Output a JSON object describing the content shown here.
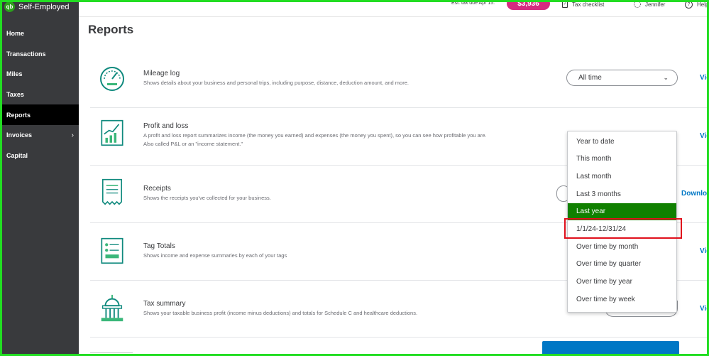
{
  "app": {
    "name": "Self-Employed",
    "logo_text": "qb"
  },
  "sidebar": {
    "items": [
      {
        "label": "Home"
      },
      {
        "label": "Transactions"
      },
      {
        "label": "Miles"
      },
      {
        "label": "Taxes"
      },
      {
        "label": "Reports",
        "active": true
      },
      {
        "label": "Invoices",
        "chevron": "›"
      },
      {
        "label": "Capital"
      }
    ]
  },
  "topbar": {
    "tax_due_label": "Est. tax due Apr 15:",
    "tax_due_amount": "$3,936",
    "checklist_label": "Tax checklist",
    "user_label": "Jennifer",
    "help_label": "Help"
  },
  "page": {
    "title": "Reports"
  },
  "reports": [
    {
      "title": "Mileage log",
      "description": "Shows details about your business and personal trips, including purpose, distance, deduction amount, and more.",
      "select_value": "All time",
      "action": "View",
      "icon": "speedometer-icon"
    },
    {
      "title": "Profit and loss",
      "description_1": "A profit and loss report summarizes income (the money you earned) and expenses (the money you spent), so you can see how profitable you are.",
      "description_2": "Also called P&L or an \"income statement.\"",
      "action": "View",
      "icon": "growth-chart-icon"
    },
    {
      "title": "Receipts",
      "description": "Shows the receipts you've collected for your business.",
      "action": "Download",
      "icon": "receipt-icon"
    },
    {
      "title": "Tag Totals",
      "description": "Shows income and expense summaries by each of your tags",
      "action": "View",
      "icon": "tag-list-icon"
    },
    {
      "title": "Tax summary",
      "description": "Shows your taxable business profit (income minus deductions) and totals for Schedule C and healthcare deductions.",
      "action": "View",
      "icon": "capitol-building-icon"
    }
  ],
  "dropdown": {
    "options": [
      {
        "label": "Year to date"
      },
      {
        "label": "This month"
      },
      {
        "label": "Last month"
      },
      {
        "label": "Last 3 months"
      },
      {
        "label": "Last year",
        "selected": true
      },
      {
        "label": "1/1/24-12/31/24",
        "highlighted": true
      },
      {
        "label": "Over time by month"
      },
      {
        "label": "Over time by quarter"
      },
      {
        "label": "Over time by year"
      },
      {
        "label": "Over time by week"
      }
    ]
  },
  "colors": {
    "brand_green": "#2ca01c",
    "selected_green": "#108000",
    "link_blue": "#0077c5",
    "tax_badge": "#d52b80",
    "highlight_red": "#e0101c",
    "frame_green": "#22dd22"
  }
}
